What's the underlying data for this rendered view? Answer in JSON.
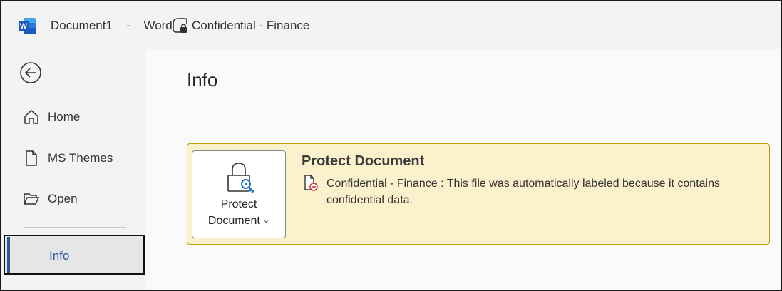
{
  "titlebar": {
    "doc_name": "Document1",
    "separator": "-",
    "app_name": "Word",
    "sensitivity_label": "Confidential - Finance",
    "app_icon": "word-logo-icon",
    "label_icon": "sensitivity-lock-icon"
  },
  "nav": {
    "back_icon": "back-arrow-icon",
    "items": [
      {
        "label": "Home",
        "icon": "home-icon"
      },
      {
        "label": "MS Themes",
        "icon": "document-icon"
      },
      {
        "label": "Open",
        "icon": "folder-open-icon"
      }
    ],
    "selected": {
      "label": "Info"
    }
  },
  "main": {
    "title": "Info",
    "protect": {
      "button_line1": "Protect",
      "button_line2": "Document",
      "heading": "Protect Document",
      "label_name": "Confidential - Finance",
      "description": "Confidential - Finance : This file was automatically labeled because it contains confidential data."
    }
  },
  "colors": {
    "accent": "#2b579a",
    "panel_bg": "#fcf1cd",
    "panel_border": "#c19c00",
    "word_blue": "#185abd",
    "label_red": "#d13438"
  }
}
